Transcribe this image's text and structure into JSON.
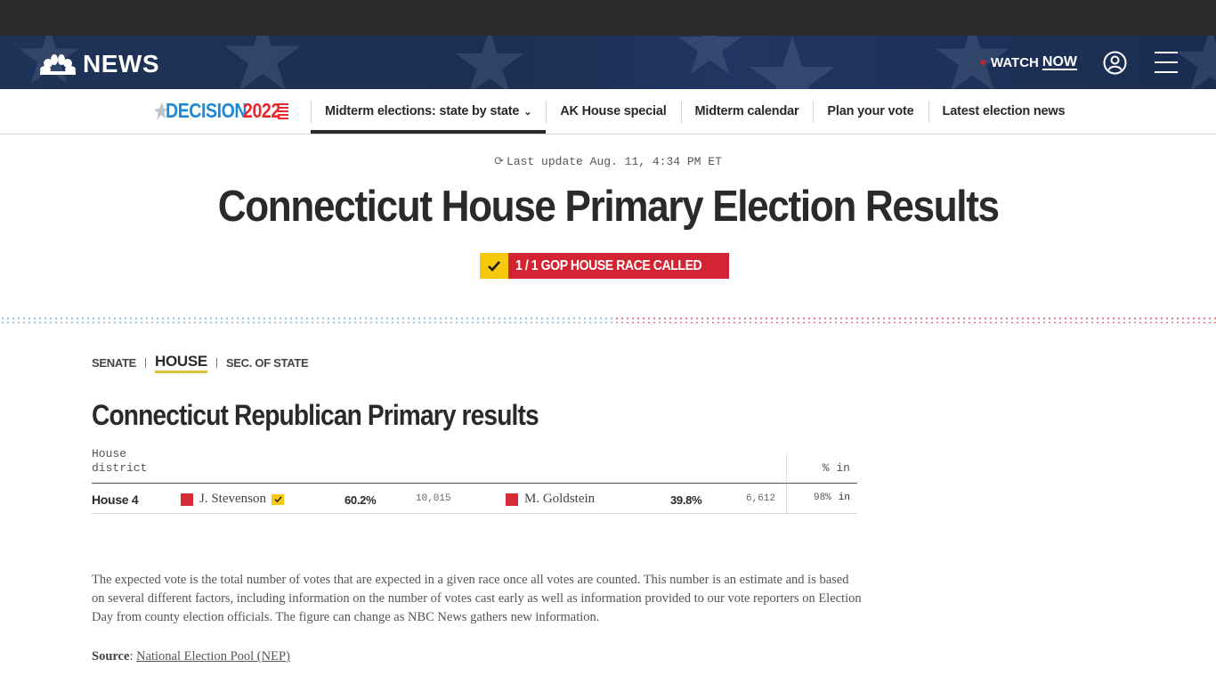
{
  "header": {
    "logo_text": "NEWS",
    "watch_label": "WATCH",
    "watch_now_label": "NOW"
  },
  "subnav": {
    "decision_word": "DECISION",
    "decision_year": "2022",
    "links": [
      {
        "label": "Midterm elections: state by state",
        "active": true,
        "has_dropdown": true
      },
      {
        "label": "AK House special"
      },
      {
        "label": "Midterm calendar"
      },
      {
        "label": "Plan your vote"
      },
      {
        "label": "Latest election news"
      }
    ]
  },
  "page": {
    "last_update": "Last update Aug. 11, 4:34 PM ET",
    "title": "Connecticut House Primary Election Results",
    "called_badge": "1 / 1 GOP HOUSE RACE CALLED"
  },
  "colors": {
    "democrat_blue": "#8fb6d8",
    "republican_red": "#d52b36",
    "called_yellow": "#f6c80e",
    "badge_red": "#d32433",
    "header_navy": "#1e3358"
  },
  "race_tabs": [
    {
      "label": "SENATE"
    },
    {
      "label": "HOUSE",
      "active": true
    },
    {
      "label": "SEC. OF STATE"
    }
  ],
  "results": {
    "section_title": "Connecticut Republican Primary results",
    "columns": {
      "district": "House district",
      "pct_in": "% in"
    },
    "rows": [
      {
        "district": "House 4",
        "candidates": [
          {
            "name": "J. Stevenson",
            "party": "GOP",
            "winner": true,
            "pct": "60.2%",
            "votes": "10,015"
          },
          {
            "name": "M. Goldstein",
            "party": "GOP",
            "winner": false,
            "pct": "39.8%",
            "votes": "6,612"
          }
        ],
        "pct_in": "98%",
        "in_label": "in"
      }
    ]
  },
  "footer": {
    "explainer": "The expected vote is the total number of votes that are expected in a given race once all votes are counted. This number is an estimate and is based on several different factors, including information on the number of votes cast early as well as information provided to our vote reporters on Election Day from county election officials. The figure can change as NBC News gathers new information.",
    "source_label": "Source",
    "source_link": "National Election Pool (NEP)"
  }
}
